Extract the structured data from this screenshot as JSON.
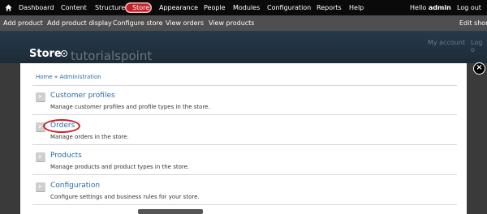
{
  "toolbar": {
    "items": [
      "Dashboard",
      "Content",
      "Structure",
      "Store",
      "Appearance",
      "People",
      "Modules",
      "Configuration",
      "Reports",
      "Help"
    ],
    "greeting_prefix": "Hello",
    "username": "admin",
    "logout": "Log out"
  },
  "shortcuts": {
    "items": [
      "Add product",
      "Add product display",
      "Configure store",
      "View orders",
      "View products"
    ],
    "edit": "Edit short"
  },
  "header": {
    "title": "Store",
    "watermark": "tutorialspoint",
    "my_account": "My account",
    "logout": "Log o"
  },
  "panel": {
    "breadcrumb": [
      "Home",
      "Administration"
    ],
    "breadcrumb_separator": "»",
    "close": "×",
    "items": [
      {
        "title": "Customer profiles",
        "description": "Manage customer profiles and profile types in the store."
      },
      {
        "title": "Orders",
        "description": "Manage orders in the store."
      },
      {
        "title": "Products",
        "description": "Manage products and product types in the store."
      },
      {
        "title": "Configuration",
        "description": "Configure settings and business rules for your store."
      }
    ]
  },
  "colors": {
    "highlight": "#cc1f26",
    "link": "#2a6ca8",
    "toolbar_bg": "#0a0a0a",
    "shortcut_bg": "#4f4f4f"
  },
  "icons": {
    "home": "home-icon",
    "gear": "gear-icon",
    "arrow": "arrow-right-icon",
    "close": "close-icon"
  }
}
